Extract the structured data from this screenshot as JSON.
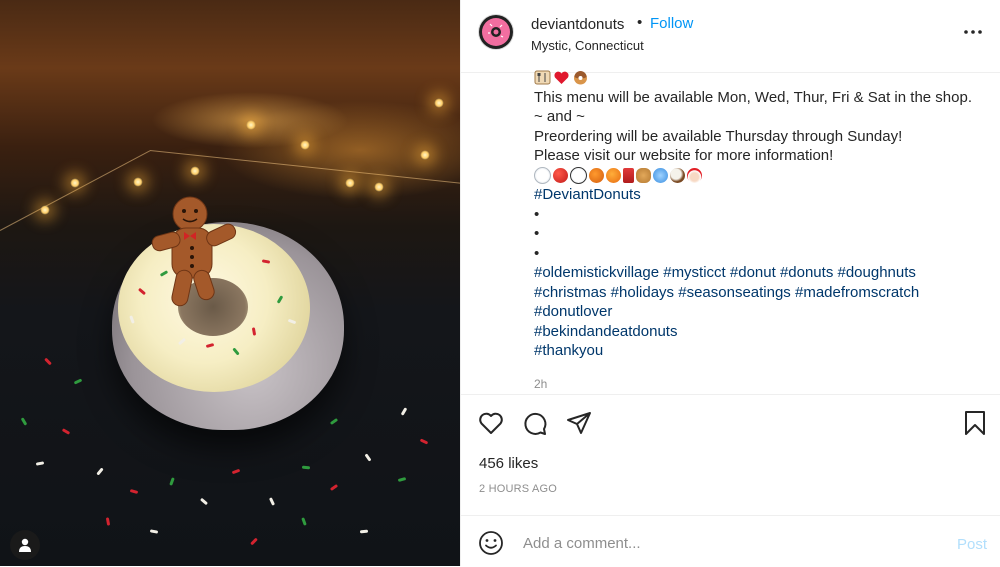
{
  "post": {
    "username": "deviantdonuts",
    "separator": "•",
    "follow_label": "Follow",
    "location": "Mystic, Connecticut"
  },
  "caption": {
    "lines": [
      "This menu will be available Mon, Wed, Thur, Fri & Sat in the shop.",
      "~ and ~",
      "Preordering will be available Thursday through Sunday!",
      "Please visit our website for more information!"
    ],
    "hashtag_main": "#DeviantDonuts",
    "bullets": [
      "•",
      "•",
      "•"
    ],
    "hashtag_lines": [
      "#oldemistickvillage #mysticct #donut #donuts #doughnuts",
      "#christmas #holidays #seasonseatings #madefromscratch",
      "#donutlover",
      "#bekindandeatdonuts",
      "#thankyou"
    ],
    "top_emojis": [
      "cutlery-icon",
      "heart-icon",
      "donut-icon"
    ],
    "emoji_row": [
      "snowman-face-icon",
      "apple-icon",
      "snowman-icon",
      "pumpkin-icon",
      "orange-icon",
      "juice-icon",
      "peanut-icon",
      "snowflake-icon",
      "coconut-icon",
      "santa-icon"
    ],
    "relative_time": "2h"
  },
  "engagement": {
    "likes": "456 likes",
    "timestamp": "2 HOURS AGO"
  },
  "comment": {
    "placeholder": "Add a comment...",
    "post_label": "Post"
  },
  "colors": {
    "link_blue": "#0095f6",
    "hashtag": "#00376b",
    "post_disabled": "#b2dffc",
    "muted": "#8e8e8e"
  }
}
